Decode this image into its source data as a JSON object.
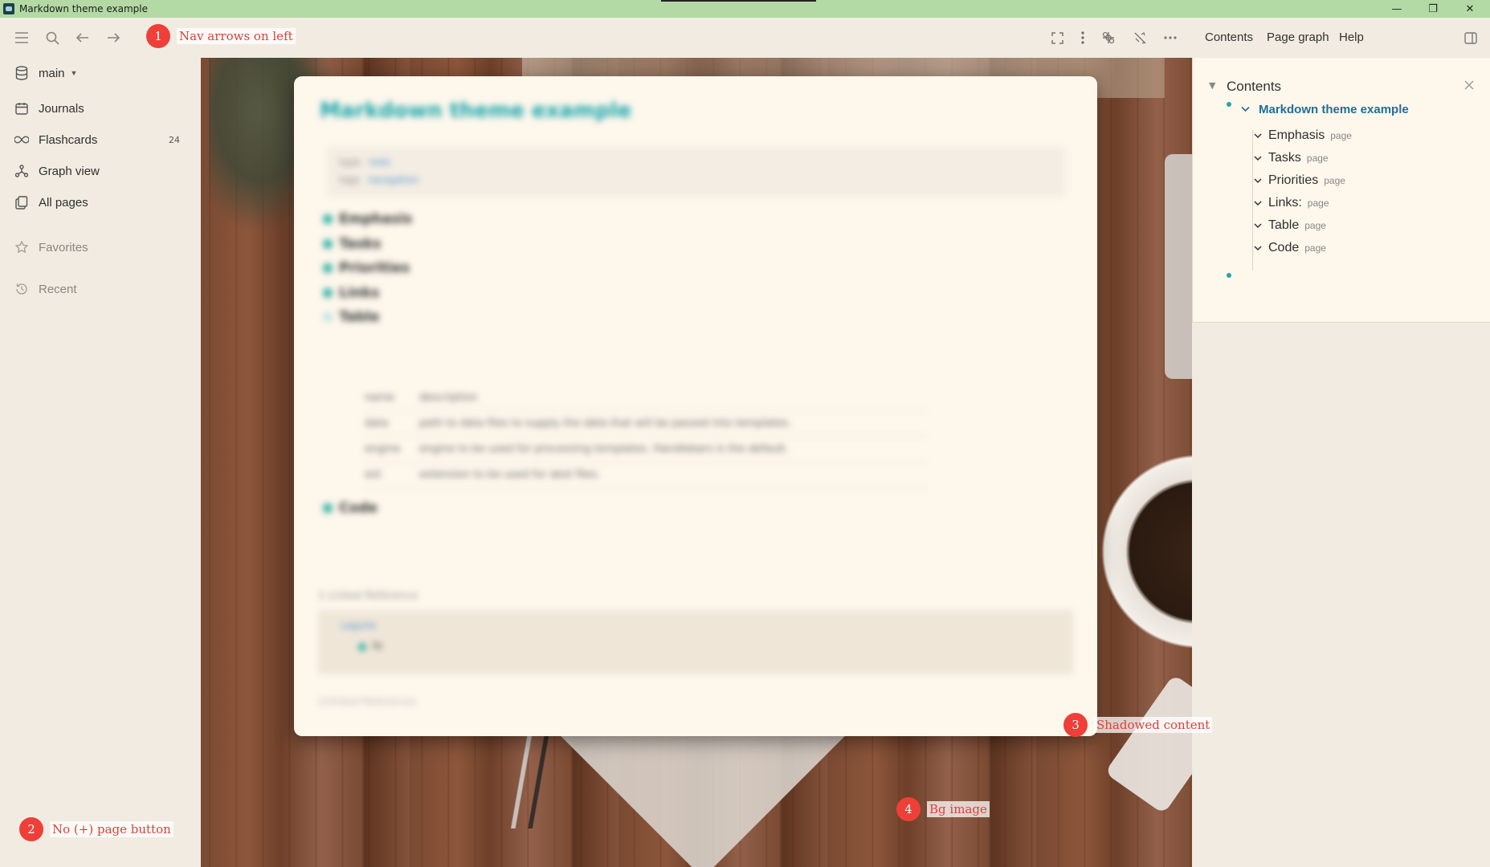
{
  "window": {
    "title": "Markdown theme example",
    "controls": {
      "minimize": "—",
      "restore": "❐",
      "close": "✕"
    }
  },
  "toolbar": {
    "icons": [
      "menu-icon",
      "search-icon",
      "arrow-left-icon",
      "arrow-right-icon",
      "fullscreen-icon",
      "more-vertical-icon",
      "plugin-icon",
      "theme-icon",
      "more-horizontal-icon",
      "right-sidebar-icon"
    ],
    "links": {
      "contents": "Contents",
      "page_graph": "Page graph",
      "help": "Help"
    }
  },
  "sidebar": {
    "graph_name": "main",
    "items": [
      {
        "label": "Journals",
        "icon": "calendar-icon"
      },
      {
        "label": "Flashcards",
        "icon": "infinity-icon",
        "count": "24"
      },
      {
        "label": "Graph view",
        "icon": "graph-icon"
      },
      {
        "label": "All pages",
        "icon": "pages-icon"
      }
    ],
    "favorites": "Favorites",
    "recent": "Recent"
  },
  "page": {
    "title": "Markdown theme example",
    "properties": [
      {
        "key": "type",
        "value": "note"
      },
      {
        "key": "tags",
        "value": "navigation"
      }
    ],
    "blocks": [
      "Emphasis",
      "Tasks",
      "Priorities",
      "Links",
      "Table",
      "Code"
    ],
    "table": {
      "header": [
        "name",
        "description"
      ],
      "rows": [
        [
          "data",
          "path to data files to supply the data that will be passed into templates."
        ],
        [
          "engine",
          "engine to be used for processing templates. Handlebars is the default."
        ],
        [
          "ext",
          "extension to be used for dest files."
        ]
      ]
    },
    "linked_refs_title": "1 Linked Reference",
    "linked_ref_page": "Lagune",
    "linked_ref_block": "hi",
    "unlinked_refs": "Unlinked References"
  },
  "contents_panel": {
    "title": "Contents",
    "root": "Markdown theme example",
    "items": [
      {
        "label": "Emphasis",
        "tag": "page"
      },
      {
        "label": "Tasks",
        "tag": "page"
      },
      {
        "label": "Priorities",
        "tag": "page"
      },
      {
        "label": "Links:",
        "tag": "page"
      },
      {
        "label": "Table",
        "tag": "page"
      },
      {
        "label": "Code",
        "tag": "page"
      }
    ]
  },
  "annotations": [
    {
      "num": "1",
      "text": "Nav arrows on left"
    },
    {
      "num": "2",
      "text": "No (+) page button"
    },
    {
      "num": "3",
      "text": "Shadowed content"
    },
    {
      "num": "4",
      "text": "Bg image"
    }
  ],
  "colors": {
    "accent": "#2aa3a6",
    "titlebar": "#b3d9a4",
    "annotation": "#ee3f38",
    "link": "#1f6f95"
  }
}
